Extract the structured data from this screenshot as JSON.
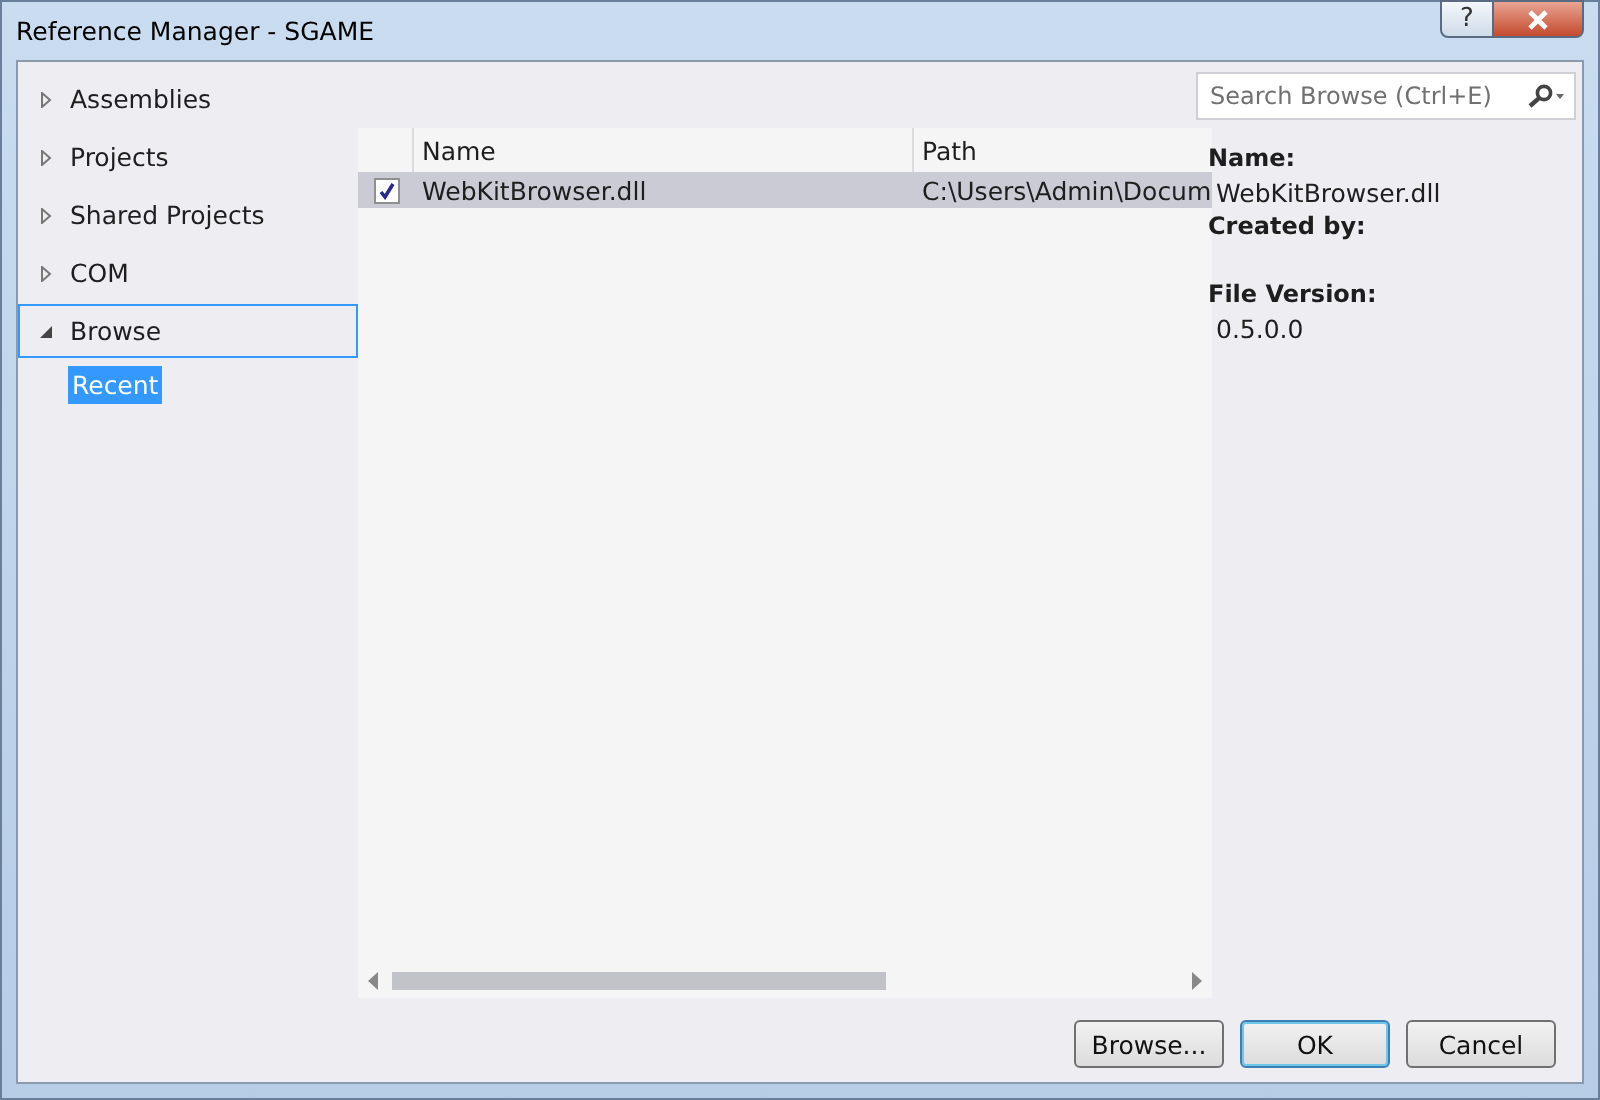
{
  "window": {
    "title": "Reference Manager - SGAME",
    "help_button": "?"
  },
  "sidebar": {
    "items": [
      {
        "label": "Assemblies",
        "expanded": false,
        "selected": false
      },
      {
        "label": "Projects",
        "expanded": false,
        "selected": false
      },
      {
        "label": "Shared Projects",
        "expanded": false,
        "selected": false
      },
      {
        "label": "COM",
        "expanded": false,
        "selected": false
      },
      {
        "label": "Browse",
        "expanded": true,
        "selected": true,
        "children": [
          {
            "label": "Recent",
            "selected": true
          }
        ]
      }
    ]
  },
  "search": {
    "placeholder": "Search Browse (Ctrl+E)"
  },
  "table": {
    "columns": [
      "Name",
      "Path"
    ],
    "rows": [
      {
        "checked": true,
        "selected": true,
        "cells": [
          "WebKitBrowser.dll",
          "C:\\Users\\Admin\\Docum"
        ]
      }
    ]
  },
  "details": [
    {
      "label": "Name:",
      "value": "WebKitBrowser.dll"
    },
    {
      "label": "Created by:"
    },
    {
      "label": "File Version:",
      "value": "0.5.0.0"
    }
  ],
  "buttons": [
    "Browse...",
    "OK",
    "Cancel"
  ]
}
